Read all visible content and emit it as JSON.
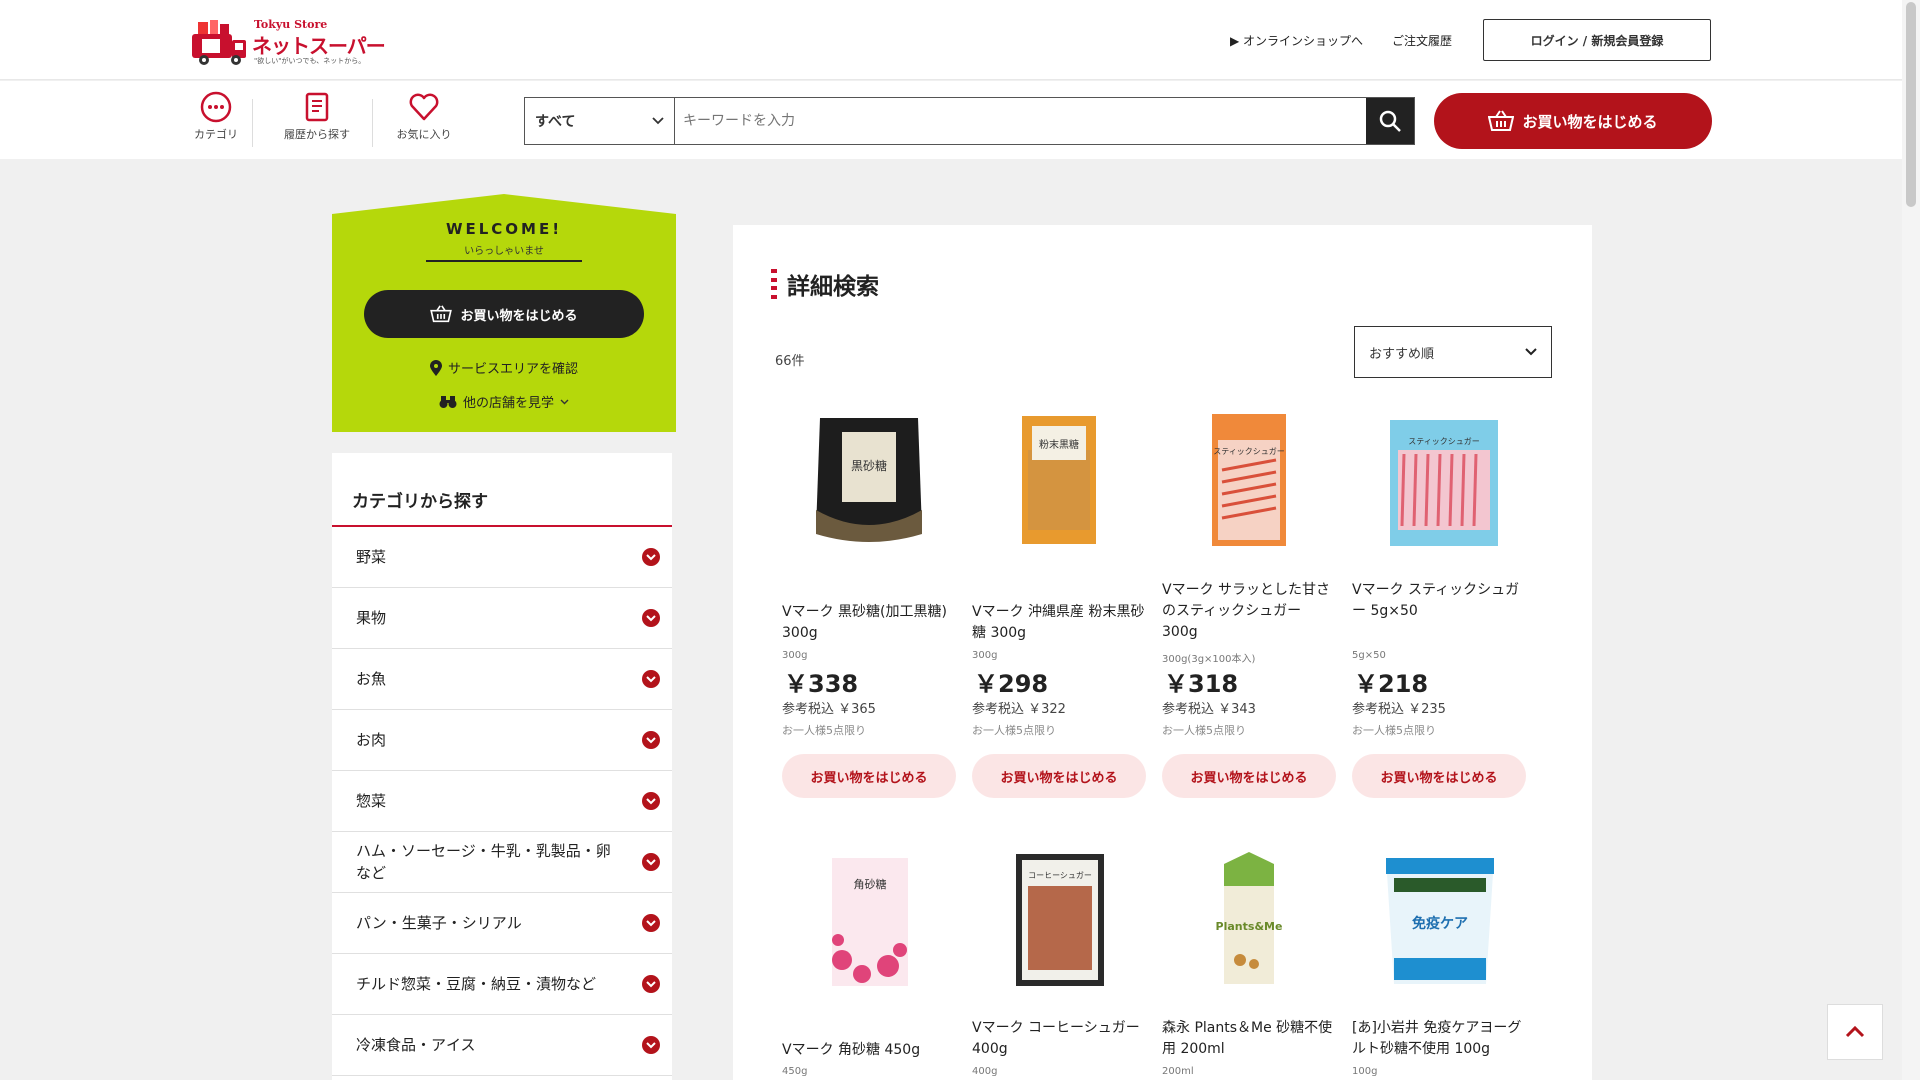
{
  "header": {
    "brand": "Tokyu Store",
    "logo_text": "ネットスーパー",
    "tagline": "\"欲しい\"がいつでも、ネットから。",
    "online_shop_link": "▶ オンラインショップへ",
    "order_history_link": "ご注文履歴",
    "login_label": "ログイン / 新規会員登録"
  },
  "nav": {
    "category": "カテゴリ",
    "history": "履歴から探す",
    "favorites": "お気に入り"
  },
  "search": {
    "select_value": "すべて",
    "placeholder": "キーワードを入力"
  },
  "start_button": "お買い物をはじめる",
  "welcome": {
    "title": "WELCOME!",
    "subtitle": "いらっしゃいませ",
    "button": "お買い物をはじめる",
    "service_area": "サービスエリアを確認",
    "other_stores": "他の店舗を見学"
  },
  "categories": {
    "title": "カテゴリから探す",
    "items": [
      "野菜",
      "果物",
      "お魚",
      "お肉",
      "惣菜",
      "ハム・ソーセージ・牛乳・乳製品・卵など",
      "パン・生菓子・シリアル",
      "チルド惣菜・豆腐・納豆・漬物など",
      "冷凍食品・アイス"
    ]
  },
  "main": {
    "title": "詳細検索",
    "count": "66件",
    "sort_value": "おすすめ順"
  },
  "products": [
    {
      "name": "Vマーク 黒砂糖(加工黒糖) 300g",
      "note": "300g",
      "price": "￥338",
      "tax": "参考税込 ￥365",
      "limit": "お一人様5点限り",
      "button": "お買い物をはじめる",
      "package_label": "黒砂糖"
    },
    {
      "name": "Vマーク 沖縄県産 粉末黒砂糖 300g",
      "note": "300g",
      "price": "￥298",
      "tax": "参考税込 ￥322",
      "limit": "お一人様5点限り",
      "button": "お買い物をはじめる",
      "package_label": "粉末黒糖"
    },
    {
      "name": "Vマーク サラッとした甘さのスティックシュガー 300g",
      "note": "300g(3g×100本入)",
      "price": "￥318",
      "tax": "参考税込 ￥343",
      "limit": "お一人様5点限り",
      "button": "お買い物をはじめる",
      "package_label": "スティックシュガー"
    },
    {
      "name": "Vマーク スティックシュガー 5g×50",
      "note": "5g×50",
      "price": "￥218",
      "tax": "参考税込 ￥235",
      "limit": "お一人様5点限り",
      "button": "お買い物をはじめる",
      "package_label": "スティックシュガー"
    },
    {
      "name": "Vマーク 角砂糖 450g",
      "note": "450g",
      "package_label": "角砂糖"
    },
    {
      "name": "Vマーク コーヒーシュガー 400g",
      "note": "400g",
      "package_label": "コーヒーシュガー"
    },
    {
      "name": "森永 Plants＆Me 砂糖不使用 200ml",
      "note": "200ml",
      "package_label": "Plants&Me"
    },
    {
      "name": "[あ]小岩井 免疫ケアヨーグルト砂糖不使用 100g",
      "note": "100g",
      "package_label": "免疫ケア"
    }
  ],
  "colors": {
    "brand_red": "#b3131b",
    "welcome_green": "#b5d80b",
    "button_pink": "#fbe5e5"
  }
}
